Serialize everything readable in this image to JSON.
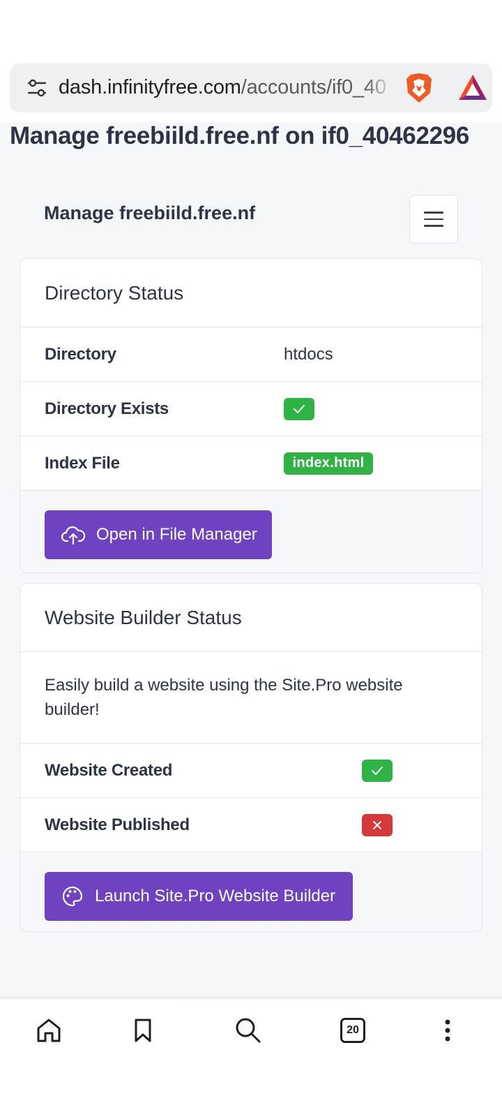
{
  "browser": {
    "url_host": "dash.infinityfree.com",
    "url_path": "/accounts/if0_40"
  },
  "page": {
    "title": "Manage freebiild.free.nf on if0_40462296",
    "subnav_title": "Manage freebiild.free.nf"
  },
  "directory_card": {
    "header": "Directory Status",
    "rows": [
      {
        "label": "Directory",
        "value": "htdocs"
      },
      {
        "label": "Directory Exists",
        "value": "✓"
      },
      {
        "label": "Index File",
        "value": "index.html"
      }
    ],
    "button_label": "Open in File Manager"
  },
  "builder_card": {
    "header": "Website Builder Status",
    "description": "Easily build a website using the Site.Pro website builder!",
    "rows": [
      {
        "label": "Website Created",
        "value": "✓"
      },
      {
        "label": "Website Published",
        "value": "✕"
      }
    ],
    "button_label": "Launch Site.Pro Website Builder"
  },
  "bottom_bar": {
    "tab_count": "20"
  },
  "colors": {
    "primary": "#6f42c1",
    "success": "#2fb344",
    "danger": "#d63939",
    "text": "#2d3446"
  }
}
